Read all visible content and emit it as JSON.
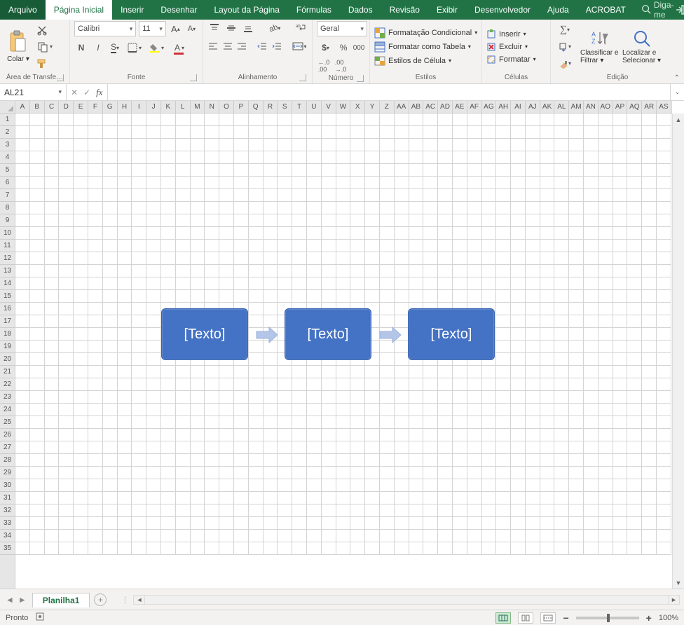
{
  "tabs": {
    "arquivo": "Arquivo",
    "pagina_inicial": "Página Inicial",
    "inserir": "Inserir",
    "desenhar": "Desenhar",
    "layout": "Layout da Página",
    "formulas": "Fórmulas",
    "dados": "Dados",
    "revisao": "Revisão",
    "exibir": "Exibir",
    "desenvolvedor": "Desenvolvedor",
    "ajuda": "Ajuda",
    "acrobat": "ACROBAT"
  },
  "tellme_placeholder": "Diga-me",
  "ribbon": {
    "clipboard": {
      "colar": "Colar",
      "label": "Área de Transfe…"
    },
    "font": {
      "name": "Calibri",
      "size": "11",
      "label": "Fonte"
    },
    "alignment": {
      "label": "Alinhamento"
    },
    "number": {
      "format": "Geral",
      "label": "Número"
    },
    "styles": {
      "cond": "Formatação Condicional",
      "table": "Formatar como Tabela",
      "cell": "Estilos de Célula",
      "label": "Estilos"
    },
    "cells": {
      "insert": "Inserir",
      "delete": "Excluir",
      "format": "Formatar",
      "label": "Células"
    },
    "editing": {
      "sort": "Classificar e Filtrar",
      "find": "Localizar e Selecionar",
      "label": "Edição"
    }
  },
  "namebox": "AL21",
  "columns": [
    "A",
    "B",
    "C",
    "D",
    "E",
    "F",
    "G",
    "H",
    "I",
    "J",
    "K",
    "L",
    "M",
    "N",
    "O",
    "P",
    "Q",
    "R",
    "S",
    "T",
    "U",
    "V",
    "W",
    "X",
    "Y",
    "Z",
    "AA",
    "AB",
    "AC",
    "AD",
    "AE",
    "AF",
    "AG",
    "AH",
    "AI",
    "AJ",
    "AK",
    "AL",
    "AM",
    "AN",
    "AO",
    "AP",
    "AQ",
    "AR",
    "AS"
  ],
  "rowcount": 35,
  "smartart": {
    "box1": "[Texto]",
    "box2": "[Texto]",
    "box3": "[Texto]"
  },
  "sheet": {
    "name": "Planilha1"
  },
  "status": {
    "ready": "Pronto",
    "zoom": "100%"
  }
}
